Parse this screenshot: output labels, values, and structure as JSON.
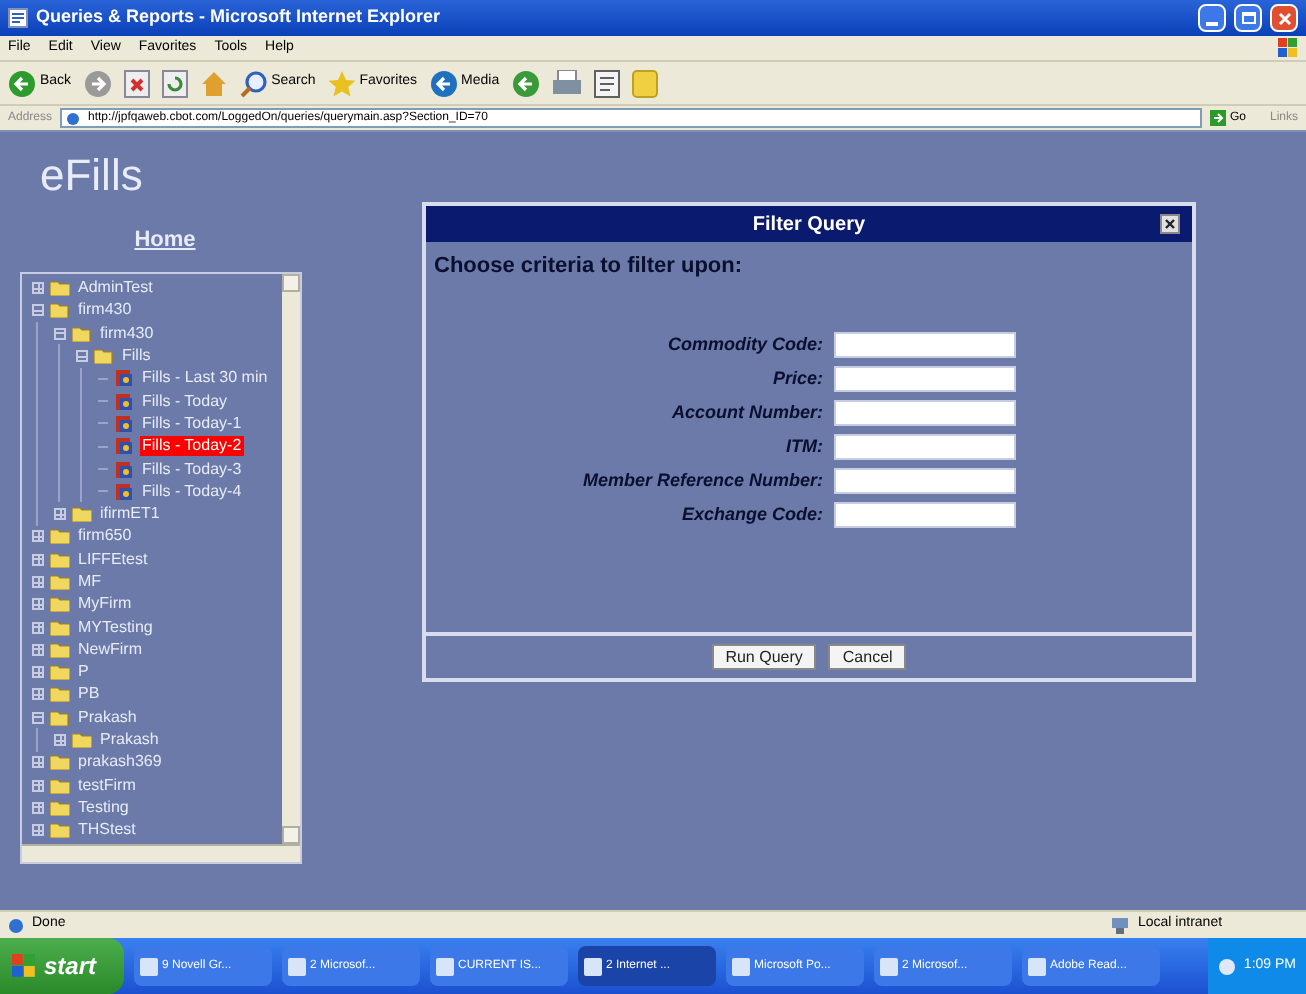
{
  "window": {
    "title": "Queries & Reports - Microsoft Internet Explorer"
  },
  "menu": [
    "File",
    "Edit",
    "View",
    "Favorites",
    "Tools",
    "Help"
  ],
  "toolbar": [
    {
      "kind": "back",
      "label": "Back"
    },
    {
      "kind": "forward"
    },
    {
      "kind": "stop"
    },
    {
      "kind": "refresh"
    },
    {
      "kind": "home"
    },
    {
      "kind": "search",
      "label": "Search"
    },
    {
      "kind": "favorites",
      "label": "Favorites"
    },
    {
      "kind": "media",
      "label": "Media"
    },
    {
      "kind": "history"
    },
    {
      "kind": "print"
    },
    {
      "kind": "edit"
    },
    {
      "kind": "notes"
    }
  ],
  "address": {
    "label": "Address",
    "url": "http://jpfqaweb.cbot.com/LoggedOn/queries/querymain.asp?Section_ID=70",
    "go": "Go",
    "links": "Links"
  },
  "page": {
    "logo": "eFills",
    "home": "Home"
  },
  "tree": [
    {
      "label": "AdminTest",
      "kind": "folder",
      "expanded": false,
      "selected": false
    },
    {
      "label": "firm430",
      "kind": "folder",
      "expanded": true,
      "selected": false,
      "children": [
        {
          "label": "firm430",
          "kind": "folder",
          "expanded": true,
          "selected": false,
          "children": [
            {
              "label": "Fills",
              "kind": "folder",
              "expanded": true,
              "selected": false,
              "children": [
                {
                  "label": "Fills - Last 30 min",
                  "kind": "report",
                  "selected": false
                },
                {
                  "label": "Fills - Today",
                  "kind": "report",
                  "selected": false
                },
                {
                  "label": "Fills - Today-1",
                  "kind": "report",
                  "selected": false
                },
                {
                  "label": "Fills - Today-2",
                  "kind": "report",
                  "selected": true
                },
                {
                  "label": "Fills - Today-3",
                  "kind": "report",
                  "selected": false
                },
                {
                  "label": "Fills - Today-4",
                  "kind": "report",
                  "selected": false
                }
              ]
            }
          ]
        },
        {
          "label": "ifirmET1",
          "kind": "folder",
          "expanded": false,
          "selected": false
        }
      ]
    },
    {
      "label": "firm650",
      "kind": "folder",
      "expanded": false,
      "selected": false
    },
    {
      "label": "LIFFEtest",
      "kind": "folder",
      "expanded": false,
      "selected": false
    },
    {
      "label": "MF",
      "kind": "folder",
      "expanded": false,
      "selected": false
    },
    {
      "label": "MyFirm",
      "kind": "folder",
      "expanded": false,
      "selected": false
    },
    {
      "label": "MYTesting",
      "kind": "folder",
      "expanded": false,
      "selected": false
    },
    {
      "label": "NewFirm",
      "kind": "folder",
      "expanded": false,
      "selected": false
    },
    {
      "label": "P",
      "kind": "folder",
      "expanded": false,
      "selected": false
    },
    {
      "label": "PB",
      "kind": "folder",
      "expanded": false,
      "selected": false
    },
    {
      "label": "Prakash",
      "kind": "folder",
      "expanded": true,
      "selected": false,
      "children": [
        {
          "label": "Prakash",
          "kind": "folder",
          "expanded": false,
          "selected": false
        }
      ]
    },
    {
      "label": "prakash369",
      "kind": "folder",
      "expanded": false,
      "selected": false
    },
    {
      "label": "testFirm",
      "kind": "folder",
      "expanded": false,
      "selected": false
    },
    {
      "label": "Testing",
      "kind": "folder",
      "expanded": false,
      "selected": false
    },
    {
      "label": "THStest",
      "kind": "folder",
      "expanded": false,
      "selected": false
    }
  ],
  "dialog": {
    "title": "Filter Query",
    "heading": "Choose criteria to filter upon:",
    "fields": [
      {
        "label": "Commodity Code:"
      },
      {
        "label": "Price:"
      },
      {
        "label": "Account Number:"
      },
      {
        "label": "ITM:"
      },
      {
        "label": "Member Reference Number:"
      },
      {
        "label": "Exchange Code:"
      }
    ],
    "buttons": [
      "Run Query",
      "Cancel"
    ]
  },
  "status_bar": {
    "text": "Done",
    "zone": "Local intranet"
  },
  "taskbar": {
    "start": "start",
    "tasks": [
      {
        "label": "9 Novell Gr...",
        "selected": false
      },
      {
        "label": "2 Microsof...",
        "selected": false
      },
      {
        "label": "CURRENT IS...",
        "selected": false
      },
      {
        "label": "2 Internet ...",
        "selected": true
      },
      {
        "label": "Microsoft Po...",
        "selected": false
      },
      {
        "label": "2 Microsof...",
        "selected": false
      },
      {
        "label": "Adobe Read...",
        "selected": false
      }
    ],
    "clock": "1:09 PM"
  }
}
